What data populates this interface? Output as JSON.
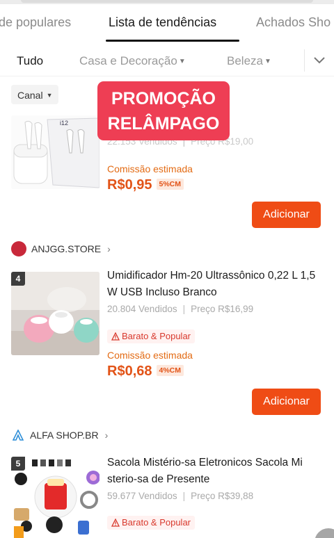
{
  "main_tabs": [
    {
      "label": "de populares"
    },
    {
      "label": "Lista de tendências"
    },
    {
      "label": "Achados Sho"
    }
  ],
  "categories": [
    {
      "label": "Tudo"
    },
    {
      "label": "Casa e Decoração"
    },
    {
      "label": "Beleza"
    }
  ],
  "filter": {
    "canal_label": "Canal"
  },
  "promo": {
    "line1": "PROMOÇÃO",
    "line2": "RELÂMPAGO"
  },
  "products": [
    {
      "thumb_text": "i12",
      "sold": "22.153 Vendidos",
      "price": "Preço R$19,00",
      "commission_label": "Comissão estimada",
      "commission_value": "R$0,95",
      "commission_pct": "5%CM",
      "add_label": "Adicionar"
    },
    {
      "store": "ANJGG.STORE",
      "rank": "4",
      "title": "Umidificador Hm-20 Ultrassônico 0,22 L 1,5 W USB Incluso Branco",
      "sold": "20.804 Vendidos",
      "price": "Preço R$16,99",
      "badge": "Barato & Popular",
      "commission_label": "Comissão estimada",
      "commission_value": "R$0,68",
      "commission_pct": "4%CM",
      "add_label": "Adicionar"
    },
    {
      "store": "ALFA SHOP.BR",
      "rank": "5",
      "title": "Sacola Mistério-sa Eletronicos Sacola Mi sterio-sa de Presente",
      "sold": "59.677 Vendidos",
      "price": "Preço R$39,88",
      "badge": "Barato & Popular"
    }
  ],
  "colors": {
    "accent": "#ef4c15",
    "promo": "#ee3e54",
    "commission": "#e25317"
  }
}
